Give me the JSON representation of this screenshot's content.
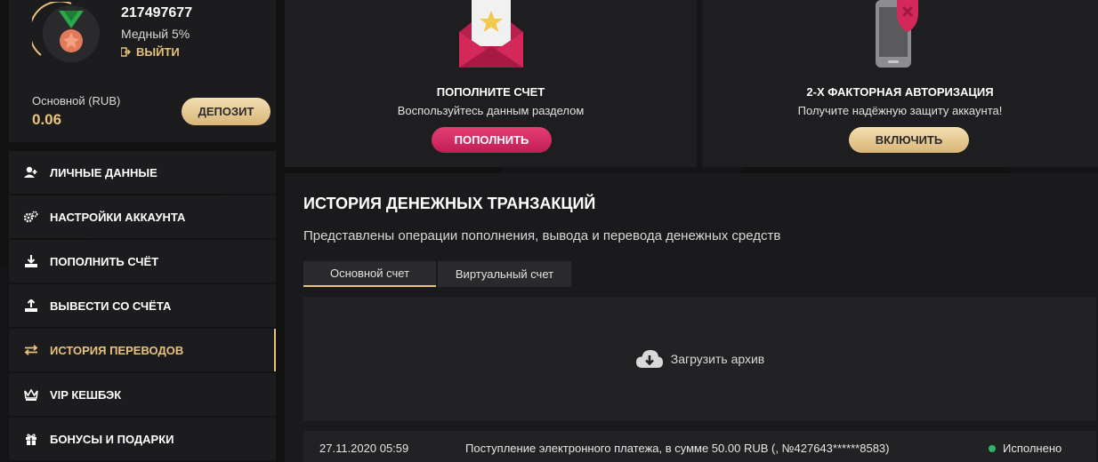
{
  "profile": {
    "user_id": "217497677",
    "level": "Медный 5%",
    "logout_label": "ВЫЙТИ",
    "balance_label": "Основной (RUB)",
    "balance_value": "0.06",
    "deposit_label": "ДЕПОЗИТ"
  },
  "menu": {
    "items": [
      {
        "label": "ЛИЧНЫЕ ДАННЫЕ",
        "icon": "user-add-icon"
      },
      {
        "label": "НАСТРОЙКИ АККАУНТА",
        "icon": "gears-icon"
      },
      {
        "label": "ПОПОЛНИТЬ СЧЁТ",
        "icon": "download-icon"
      },
      {
        "label": "ВЫВЕСТИ СО СЧЁТА",
        "icon": "upload-icon"
      },
      {
        "label": "ИСТОРИЯ ПЕРЕВОДОВ",
        "icon": "transfer-arrows-icon",
        "active": true
      },
      {
        "label": "VIP КЕШБЭК",
        "icon": "crown-icon"
      },
      {
        "label": "БОНУСЫ И ПОДАРКИ",
        "icon": "gift-icon"
      }
    ]
  },
  "promos": {
    "topup": {
      "title": "ПОПОЛНИТЕ СЧЕТ",
      "subtitle": "Воспользуйтесь данным разделом",
      "button": "ПОПОЛНИТЬ"
    },
    "twofa": {
      "title": "2-Х ФАКТОРНАЯ АВТОРИЗАЦИЯ",
      "subtitle": "Получите надёжную защиту аккаунта!",
      "button": "ВКЛЮЧИТЬ"
    }
  },
  "history": {
    "title": "ИСТОРИЯ ДЕНЕЖНЫХ ТРАНЗАКЦИЙ",
    "subtitle": "Представлены операции пополнения, вывода и перевода денежных средств",
    "tabs": [
      "Основной счет",
      "Виртуальный счет"
    ],
    "archive_label": "Загрузить архив",
    "rows": [
      {
        "date": "27.11.2020 05:59",
        "description": "Поступление электронного платежа, в сумме 50.00 RUB (, №427643******8583)",
        "status": "Исполнено"
      }
    ]
  },
  "colors": {
    "accent_gold": "#e9c27c",
    "accent_pink": "#d22a62",
    "status_green": "#2db66a"
  }
}
